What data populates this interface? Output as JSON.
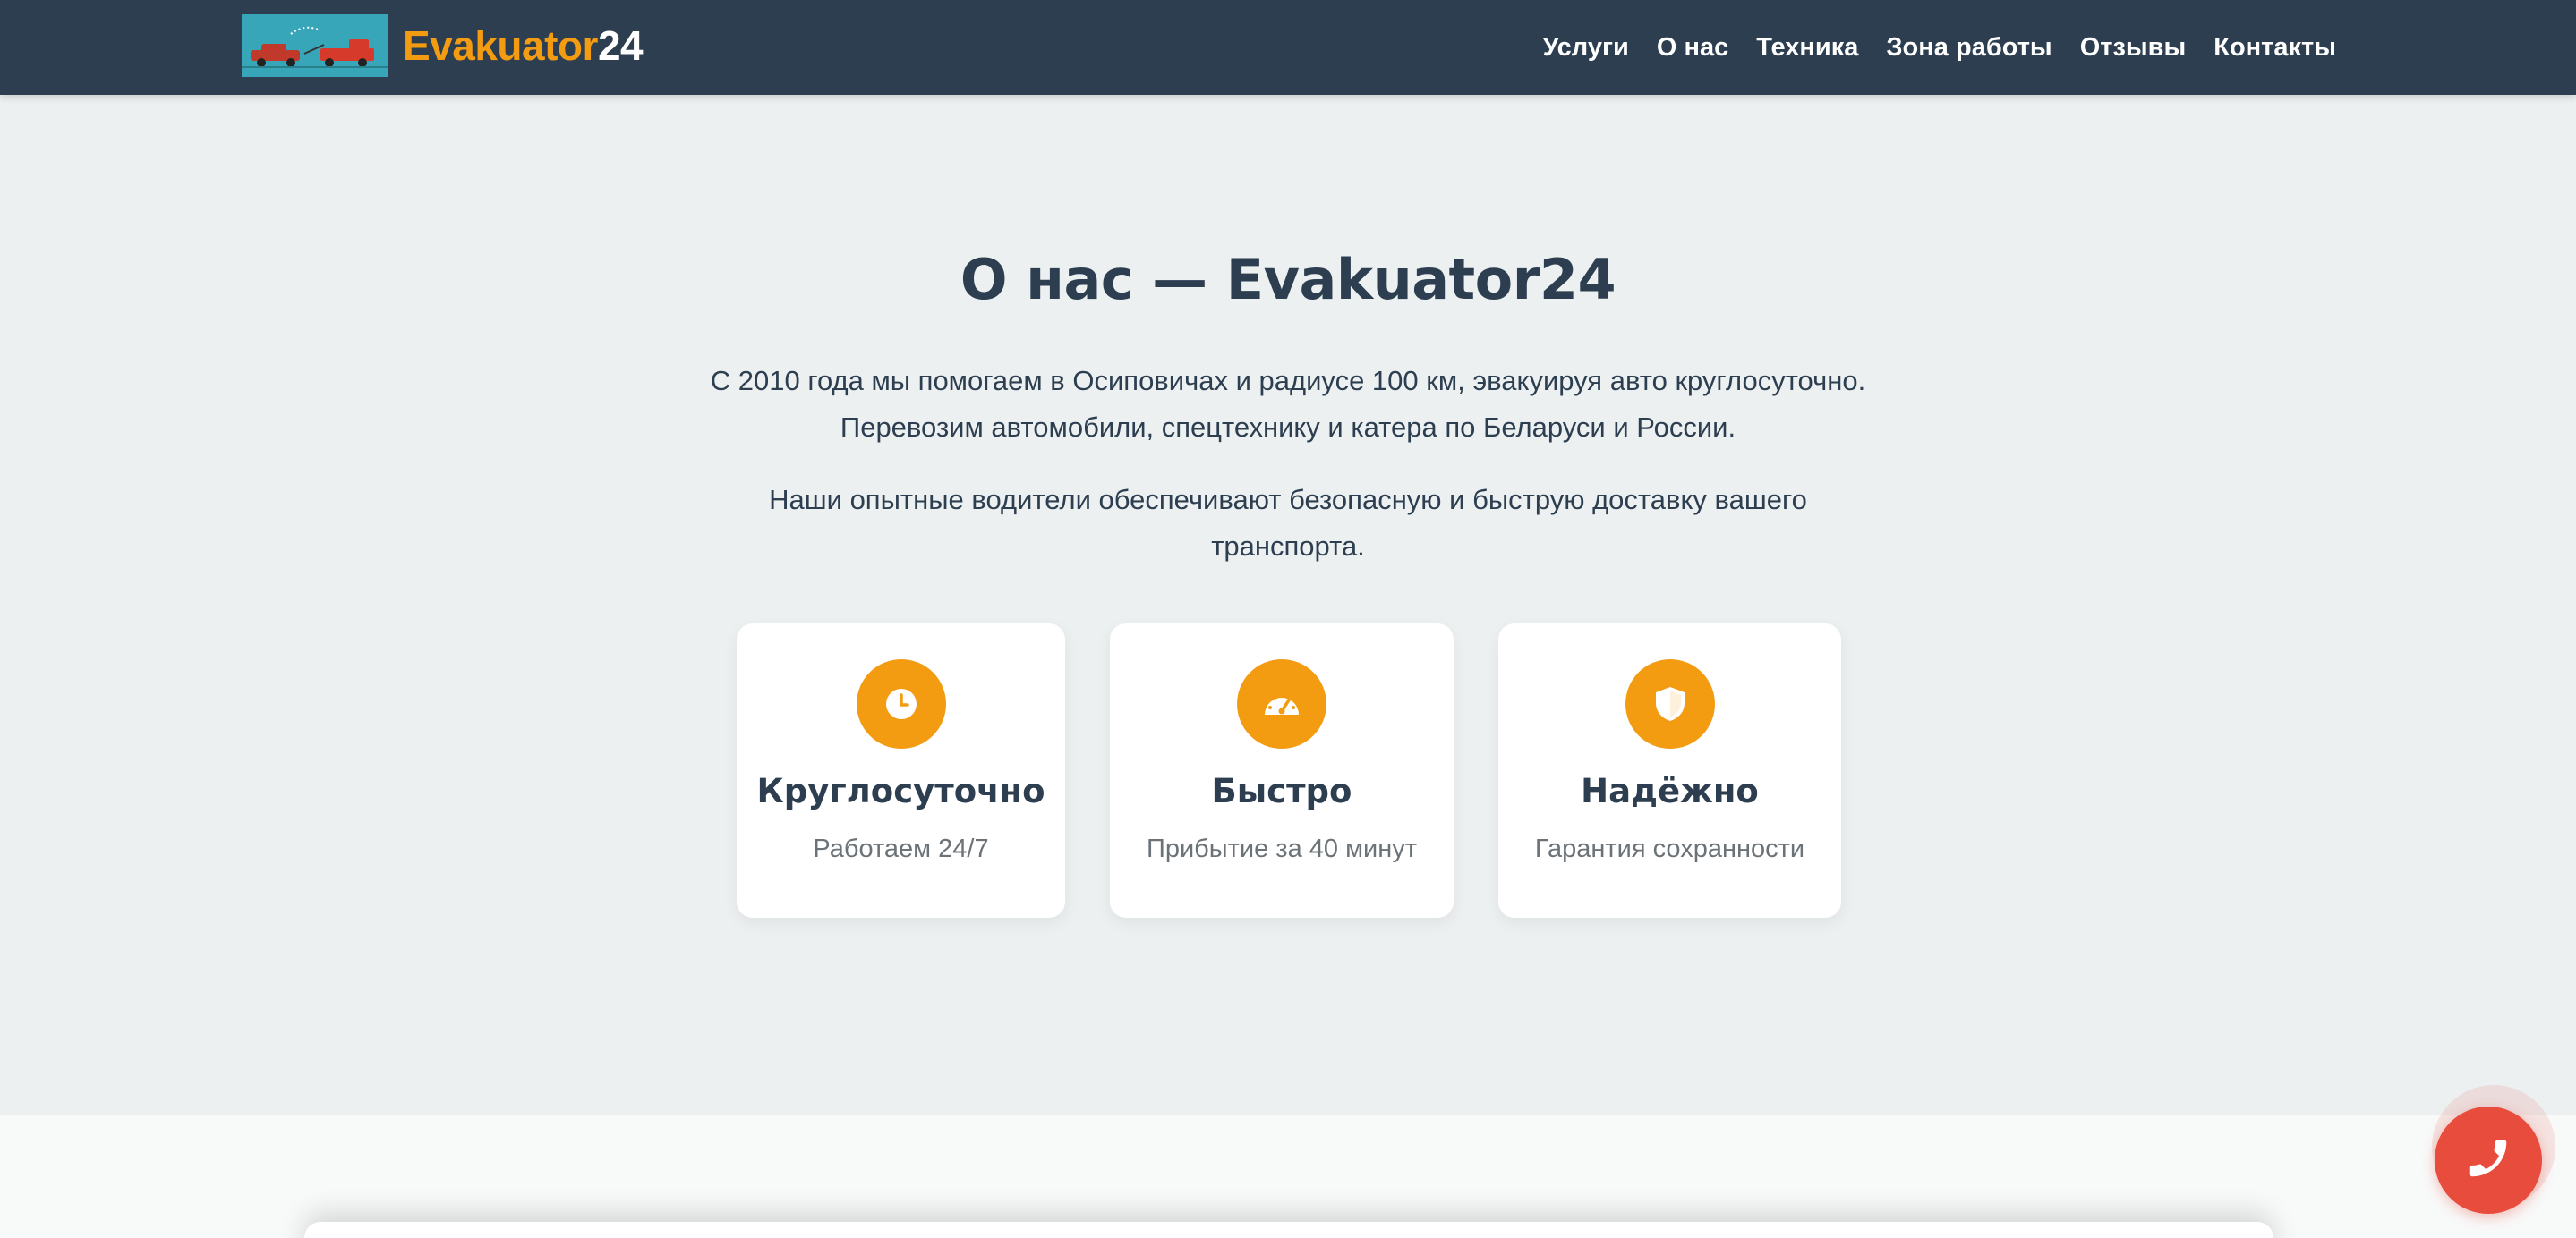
{
  "header": {
    "logo_alt": "truck-tow-logo",
    "brand_name": "Evakuator",
    "brand_number": "24",
    "nav": [
      {
        "label": "Услуги"
      },
      {
        "label": "О нас"
      },
      {
        "label": "Техника"
      },
      {
        "label": "Зона работы"
      },
      {
        "label": "Отзывы"
      },
      {
        "label": "Контакты"
      }
    ]
  },
  "about": {
    "title": "О нас — Evakuator24",
    "paragraph_1": "С 2010 года мы помогаем в Осиповичах и радиусе 100 км, эвакуируя авто круглосуточно. Перевозим автомобили, спецтехнику и катера по Беларуси и России.",
    "paragraph_2": "Наши опытные водители обеспечивают безопасную и быструю доставку вашего транспорта.",
    "features": [
      {
        "icon": "clock-icon",
        "title": "Круглосуточно",
        "subtitle": "Работаем 24/7"
      },
      {
        "icon": "speedometer-icon",
        "title": "Быстро",
        "subtitle": "Прибытие за 40 минут"
      },
      {
        "icon": "shield-icon",
        "title": "Надёжно",
        "subtitle": "Гарантия сохранности"
      }
    ]
  },
  "call_button": {
    "icon": "phone-icon"
  },
  "colors": {
    "header_bg": "#2c3e50",
    "accent": "#f39c12",
    "section_bg": "#ecf0f1",
    "call_red": "#e74c3c"
  }
}
